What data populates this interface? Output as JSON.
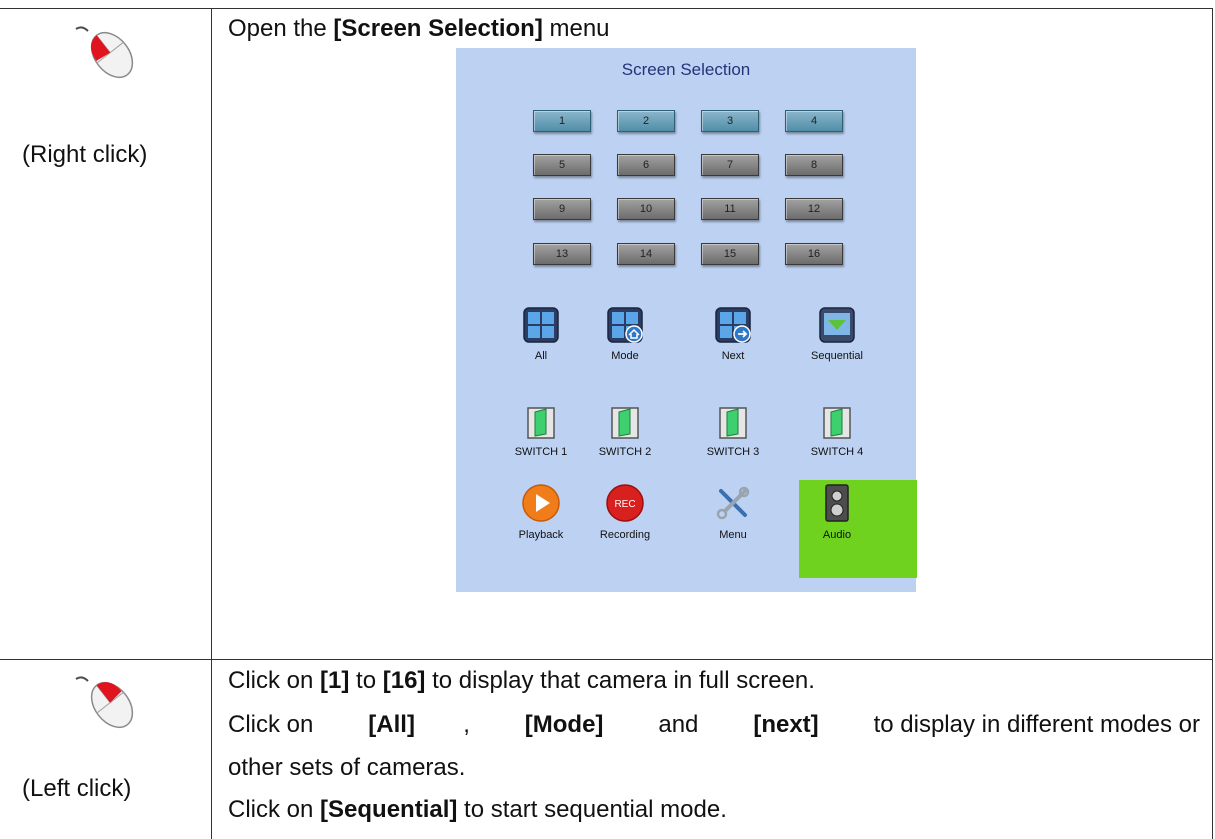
{
  "rows": [
    {
      "click_label": "(Right click)",
      "instruction": {
        "prefix": "Open the ",
        "bold": "[Screen Selection]",
        "suffix": " menu"
      }
    },
    {
      "click_label": "(Left click)",
      "lines": [
        {
          "parts": [
            {
              "t": "Click on ",
              "b": false
            },
            {
              "t": "[1]",
              "b": true
            },
            {
              "t": " to ",
              "b": false
            },
            {
              "t": "[16]",
              "b": true
            },
            {
              "t": " to display that camera in full screen.",
              "b": false
            }
          ]
        },
        {
          "parts": [
            {
              "t": "Click on ",
              "b": false
            },
            {
              "t": "[All]",
              "b": true
            },
            {
              "t": ", ",
              "b": false
            },
            {
              "t": "[Mode]",
              "b": true
            },
            {
              "t": " and ",
              "b": false
            },
            {
              "t": "[next]",
              "b": true
            },
            {
              "t": " to display in different modes or",
              "b": false
            }
          ]
        },
        {
          "parts": [
            {
              "t": "other sets of cameras.",
              "b": false
            }
          ]
        },
        {
          "parts": [
            {
              "t": "Click on ",
              "b": false
            },
            {
              "t": "[Sequential]",
              "b": true
            },
            {
              "t": " to start sequential mode.",
              "b": false
            }
          ]
        }
      ]
    }
  ],
  "panel": {
    "title": "Screen Selection",
    "camera_buttons": [
      "1",
      "2",
      "3",
      "4",
      "5",
      "6",
      "7",
      "8",
      "9",
      "10",
      "11",
      "12",
      "13",
      "14",
      "15",
      "16"
    ],
    "active_buttons": [
      "1",
      "2",
      "3",
      "4"
    ],
    "mode_buttons": [
      {
        "label": "All",
        "icon": "grid-all-icon"
      },
      {
        "label": "Mode",
        "icon": "grid-mode-icon"
      },
      {
        "label": "Next",
        "icon": "grid-next-icon"
      },
      {
        "label": "Sequential",
        "icon": "sequential-icon"
      }
    ],
    "switch_buttons": [
      {
        "label": "SWITCH 1",
        "icon": "switch-icon"
      },
      {
        "label": "SWITCH 2",
        "icon": "switch-icon"
      },
      {
        "label": "SWITCH 3",
        "icon": "switch-icon"
      },
      {
        "label": "SWITCH 4",
        "icon": "switch-icon"
      }
    ],
    "action_buttons": [
      {
        "label": "Playback",
        "icon": "play-icon"
      },
      {
        "label": "Recording",
        "icon": "rec-icon",
        "badge": "REC"
      },
      {
        "label": "Menu",
        "icon": "tools-icon"
      },
      {
        "label": "Audio",
        "icon": "speaker-icon",
        "highlighted": true
      }
    ],
    "colors": {
      "panel_bg": "#bdd1f2",
      "title": "#24337a",
      "audio_highlight": "#6fd21f"
    }
  }
}
